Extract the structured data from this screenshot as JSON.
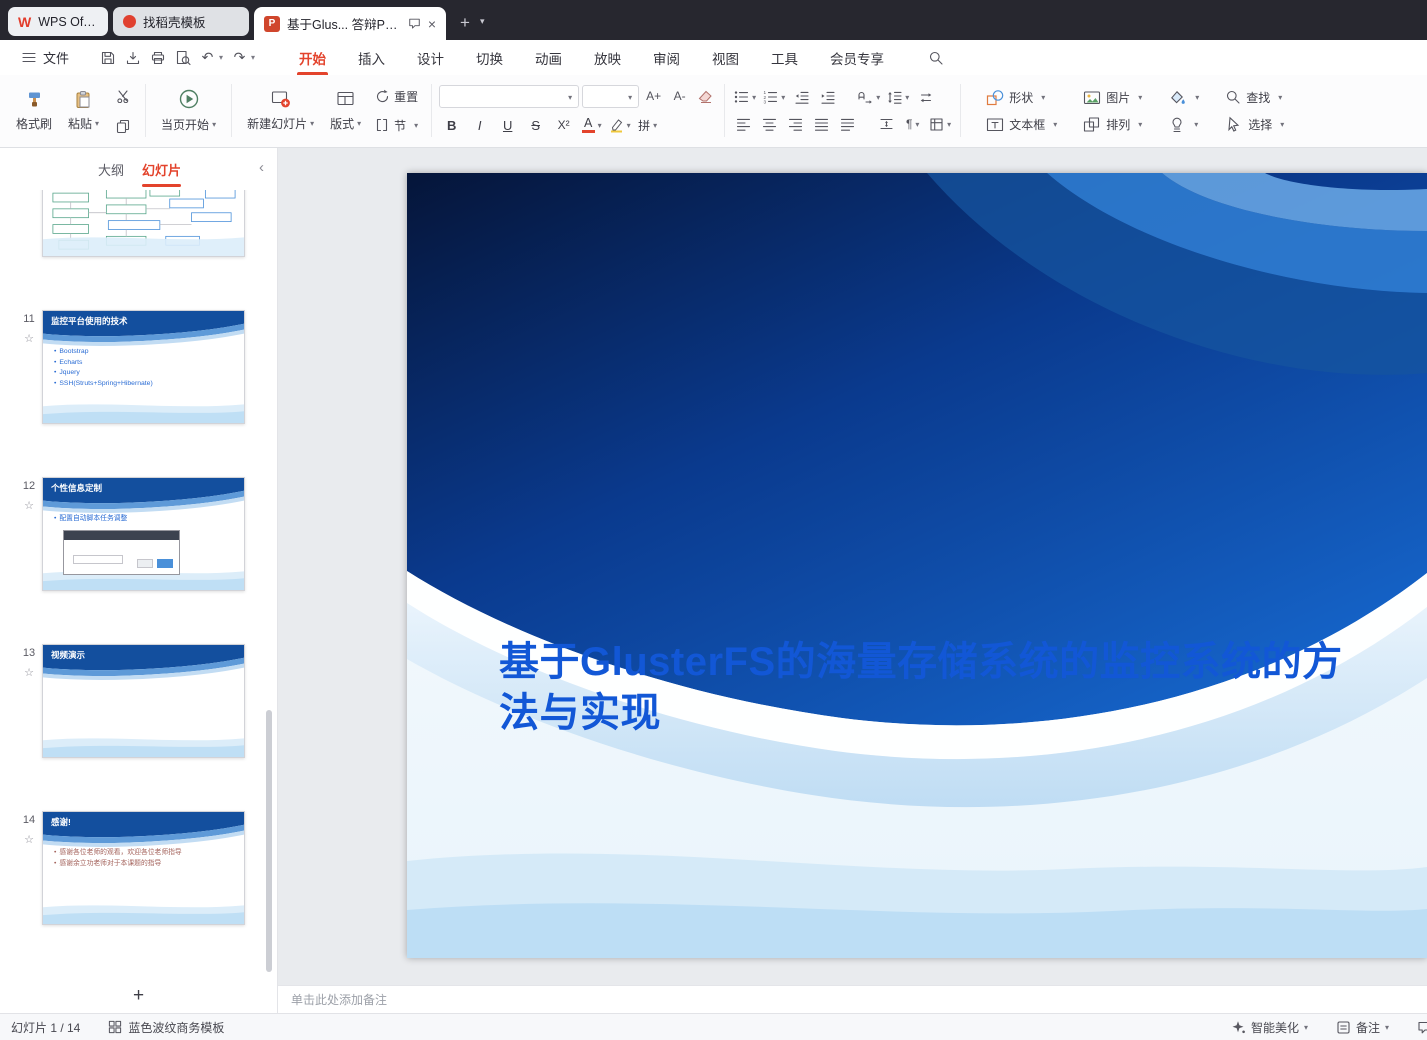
{
  "colors": {
    "accent": "#e3432c",
    "titlebar_bg": "#27272f",
    "slide_title": "#1257d6",
    "template_blue": "#0d47a1"
  },
  "titlebar": {
    "tabs": [
      {
        "label": "WPS Office"
      },
      {
        "label": "找稻壳模板"
      },
      {
        "label": "基于Glus... 答辩PPT"
      }
    ]
  },
  "menubar": {
    "file": "文件",
    "items": [
      "开始",
      "插入",
      "设计",
      "切换",
      "动画",
      "放映",
      "审阅",
      "视图",
      "工具",
      "会员专享"
    ]
  },
  "ribbon": {
    "format_painter": "格式刷",
    "paste": "粘贴",
    "play_current": "当页开始",
    "new_slide": "新建幻灯片",
    "layout": "版式",
    "reset": "重置",
    "section": "节",
    "font_name": "",
    "font_size": "",
    "shapes": "形状",
    "picture": "图片",
    "textbox": "文本框",
    "arrange": "排列",
    "find": "查找",
    "select": "选择"
  },
  "icons": {
    "undo": "↶",
    "redo": "↷",
    "bold": "B",
    "italic": "I",
    "underline": "U",
    "strike": "S",
    "superscript": "X²",
    "font_color": "A",
    "phonetic": "拼",
    "increase_font": "A+",
    "decrease_font": "A-"
  },
  "sidebar": {
    "outline_tab": "大纲",
    "slides_tab": "幻灯片",
    "slides": [
      {
        "kind": "flowchart"
      },
      {
        "number": "11",
        "title": "监控平台使用的技术",
        "bullets": [
          "Bootstrap",
          "Echarts",
          "Jquery",
          "SSH(Struts+Spring+Hibernate)"
        ]
      },
      {
        "number": "12",
        "title": "个性信息定制",
        "bullets": [
          "配置自动脚本任务调整"
        ]
      },
      {
        "number": "13",
        "title": "视频演示",
        "bullets": []
      },
      {
        "number": "14",
        "title": "感谢!",
        "bullets": [
          "感谢各位老师的观看，欢迎各位老师指导",
          "感谢余立功老师对于本课题的指导"
        ]
      }
    ]
  },
  "slide": {
    "title": "基于GlusterFS的海量存储系统的监控系统的方法与实现"
  },
  "notes": {
    "placeholder": "单击此处添加备注"
  },
  "statusbar": {
    "position": "幻灯片 1 / 14",
    "template": "蓝色波纹商务模板",
    "beautify": "智能美化",
    "notes_label": "备注"
  }
}
